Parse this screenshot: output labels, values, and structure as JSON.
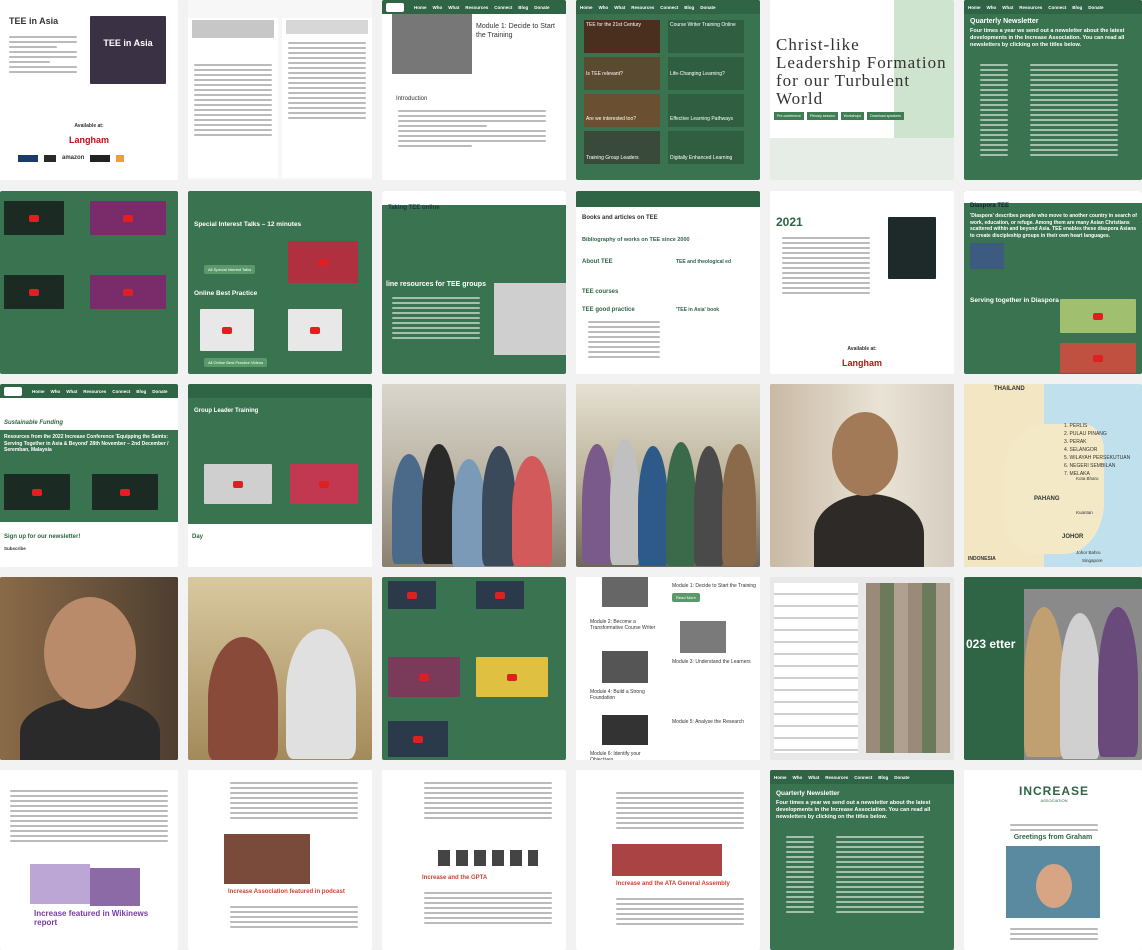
{
  "nav_items": [
    "Home",
    "Who",
    "What",
    "Resources",
    "Connect",
    "Blog",
    "Donate"
  ],
  "tiles": {
    "t1": {
      "title": "TEE in Asia",
      "book_title": "TEE in Asia",
      "available": "Available at:",
      "publisher": "Langham",
      "retailers": [
        "amazon"
      ]
    },
    "t3": {
      "title": "Module 1: Decide to Start the Training",
      "intro": "Introduction"
    },
    "t4": {
      "items": [
        "TEE for the 21st Century",
        "Course Writer Training Online",
        "Is TEE relevant?",
        "Life-Changing Learning?",
        "Are we interested too?",
        "Effective Learning Pathways",
        "Training Group Leaders",
        "Digitally Enhanced Learning"
      ]
    },
    "t5": {
      "heading": "Christ-like Leadership Formation for our Turbulent World",
      "buttons": [
        "Pre-conference",
        "Plenary session",
        "Workshops",
        "Download speakers"
      ]
    },
    "t6": {
      "title": "Quarterly Newsletter",
      "intro": "Four times a year we send out a newsletter about the latest developments in the Increase Association. You can read all newsletters by clicking on the titles below."
    },
    "t8": {
      "title": "Special Interest Talks – 12 minutes",
      "section": "Online Best Practice",
      "btn1": "All Special Interest Talks",
      "btn2": "All Online Best Practice Videos"
    },
    "t9": {
      "title": "Taking TEE online",
      "sub": "line resources for TEE groups"
    },
    "t10": {
      "title": "Books and articles on TEE",
      "bib": "Bibliography of works on TEE since 2000",
      "h1": "About TEE",
      "h2": "TEE courses",
      "h3": "TEE good practice",
      "h4": "TEE and theological ed",
      "h5": "'TEE in Asia' book"
    },
    "t11": {
      "year": "2021",
      "available": "Available at:",
      "publisher": "Langham"
    },
    "t12": {
      "title": "Diaspora TEE",
      "intro": "'Diaspora' describes people who move to another country in search of work, education, or refuge. Among them are many Asian Christians scattered within and beyond Asia. TEE enables these diaspora Asians to create discipleship groups in their own heart languages.",
      "section": "Serving together in Diaspora"
    },
    "t13": {
      "title": "Sustainable Funding",
      "conf": "Resources from the 2022 Increase Conference 'Equipping the Saints: Serving Together in Asia & Beyond' 28th November – 2nd December / Seremban, Malaysia",
      "signup": "Sign up for our newsletter!",
      "subscribe": "Subscribe"
    },
    "t14": {
      "title": "Group Leader Training",
      "day": "Day"
    },
    "t18": {
      "country": "THAILAND",
      "states": [
        "1. PERLIS",
        "2. PULAU PINANG",
        "3. PERAK",
        "4. SELANGOR",
        "5. WILAYAH PERSEKUTUAN",
        "6. NEGERI SEMBILAN",
        "7. MELAKA"
      ],
      "places": [
        "Kota Bharu",
        "PAHANG",
        "Kuantan",
        "JOHOR",
        "INDONESIA",
        "Johor Bahru",
        "Singapore"
      ]
    },
    "t23": {
      "modules": [
        "Module 1: Decide to Start the Training",
        "Module 2: Become a Transformative Course Writer",
        "Module 3: Understand the Learners",
        "Module 4: Build a Strong Foundation",
        "Module 5: Analyse the Research",
        "Module 6: Identify your Objectives"
      ],
      "btn": "Read More"
    },
    "t25": {
      "partial": "023 etter"
    },
    "t26": {
      "caption": "Increase featured in Wikinews report"
    },
    "t27": {
      "caption": "Increase Association featured in podcast"
    },
    "t28": {
      "caption": "Increase and the GPTA"
    },
    "t29": {
      "caption": "Increase and the ATA General Assembly"
    },
    "t30": {
      "title": "Quarterly Newsletter",
      "intro": "Four times a year we send out a newsletter about the latest developments in the Increase Association. You can read all newsletters by clicking on the titles below."
    },
    "t31": {
      "brand": "INCREASE",
      "tagline": "ASSOCIATION",
      "greeting": "Greetings from Graham"
    }
  },
  "colors": {
    "brand_green": "#3a7350",
    "nav_green": "#2f6544",
    "accent_red": "#e02020"
  }
}
